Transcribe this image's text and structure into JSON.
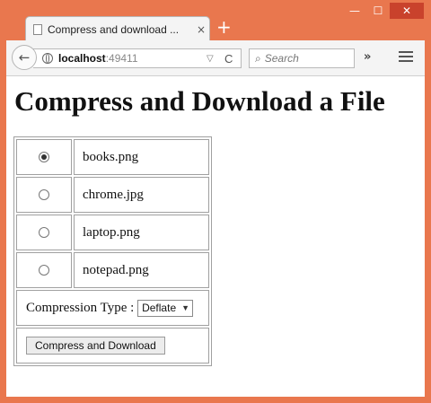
{
  "browser": {
    "tab_title": "Compress and download ...",
    "tab_close": "×",
    "new_tab": "+",
    "back_arrow": "←",
    "url_host": "localhost",
    "url_port": ":49411",
    "url_dropdown": "▽",
    "url_reload": "C",
    "search_placeholder": "Search",
    "overflow": "»",
    "window_controls": {
      "minimize": "—",
      "maximize": "☐",
      "close": "✕"
    }
  },
  "page": {
    "title": "Compress and Download a File",
    "files": [
      {
        "name": "books.png",
        "selected": true
      },
      {
        "name": "chrome.jpg",
        "selected": false
      },
      {
        "name": "laptop.png",
        "selected": false
      },
      {
        "name": "notepad.png",
        "selected": false
      }
    ],
    "compression_label": "Compression Type :",
    "compression_value": "Deflate",
    "button_label": "Compress and Download"
  }
}
